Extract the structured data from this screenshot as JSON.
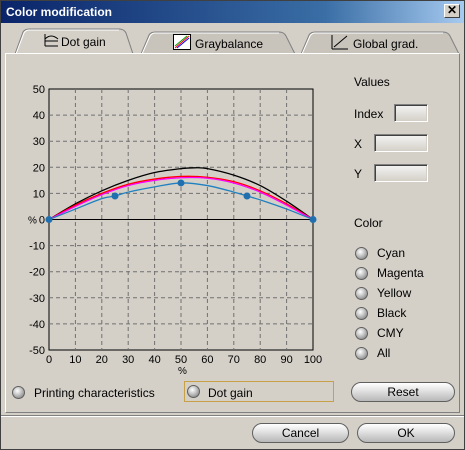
{
  "window": {
    "title": "Color modification",
    "close_glyph": "✕"
  },
  "tabs": [
    {
      "label": "Dot gain",
      "icon": "dot-gain-curve-icon",
      "active": true
    },
    {
      "label": "Graybalance",
      "icon": "graybalance-curves-icon",
      "active": false
    },
    {
      "label": "Global grad.",
      "icon": "global-gradation-icon",
      "active": false
    }
  ],
  "values": {
    "heading": "Values",
    "index_label": "Index",
    "x_label": "X",
    "y_label": "Y",
    "index_value": "",
    "x_value": "",
    "y_value": ""
  },
  "color": {
    "heading": "Color",
    "options": [
      "Cyan",
      "Magenta",
      "Yellow",
      "Black",
      "CMY",
      "All"
    ]
  },
  "bottom": {
    "printing_label": "Printing characteristics",
    "dot_gain_label": "Dot gain",
    "reset_label": "Reset",
    "cancel_label": "Cancel",
    "ok_label": "OK"
  },
  "chart_data": {
    "type": "line",
    "title": "",
    "xlabel": "%",
    "ylabel": "%",
    "xlim": [
      0,
      100
    ],
    "ylim": [
      -50,
      50
    ],
    "xticks": [
      0,
      10,
      20,
      30,
      40,
      50,
      60,
      70,
      80,
      90,
      100
    ],
    "yticks": [
      50,
      40,
      30,
      20,
      10,
      0,
      -10,
      -20,
      -30,
      -40,
      -50
    ],
    "grid": true,
    "series": [
      {
        "color": "#000000",
        "x": [
          0,
          10,
          20,
          30,
          40,
          50,
          55,
          60,
          70,
          80,
          90,
          100
        ],
        "y": [
          0,
          6,
          11,
          15,
          18,
          19.5,
          19.8,
          19.5,
          17,
          13,
          7,
          0
        ]
      },
      {
        "color": "#ff0000",
        "x": [
          0,
          10,
          20,
          30,
          40,
          50,
          60,
          70,
          80,
          90,
          100
        ],
        "y": [
          0,
          5.5,
          10,
          13.5,
          15.5,
          16.5,
          16.2,
          14.5,
          11,
          6,
          0
        ]
      },
      {
        "color": "#ff00ff",
        "x": [
          0,
          10,
          20,
          30,
          40,
          50,
          60,
          70,
          80,
          90,
          100
        ],
        "y": [
          0,
          5,
          9.5,
          13,
          15,
          16,
          15.8,
          14,
          10.5,
          5.5,
          0
        ]
      },
      {
        "color": "#2080c0",
        "x": [
          0,
          10,
          20,
          25,
          30,
          40,
          50,
          60,
          70,
          75,
          80,
          90,
          100
        ],
        "y": [
          0,
          4,
          8,
          9,
          10.5,
          12.5,
          14,
          13,
          10.5,
          9,
          7.5,
          4,
          0
        ]
      }
    ],
    "points": {
      "color": "#2070b0",
      "x": [
        0,
        25,
        50,
        75,
        100
      ],
      "y": [
        0,
        9,
        14,
        9,
        0
      ]
    }
  }
}
